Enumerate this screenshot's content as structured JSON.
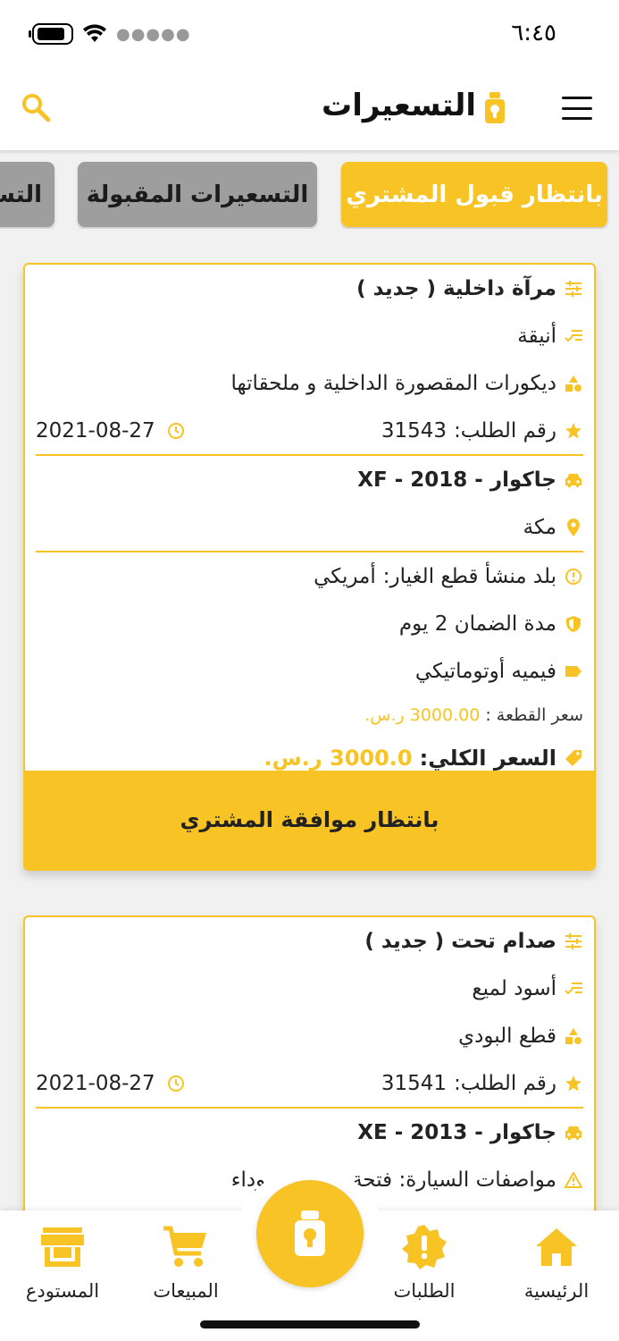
{
  "status_bar": {
    "time": "٦:٤٥"
  },
  "header": {
    "title": "التسعيرات"
  },
  "tabs": [
    {
      "label": "بانتظار قبول المشتري"
    },
    {
      "label": "التسعيرات المقبولة"
    },
    {
      "label": "التس"
    }
  ],
  "cards": [
    {
      "part": "مرآة داخلية ( جديد )",
      "quality": "أنيقة",
      "category": "ديكورات المقصورة الداخلية و ملحقاتها",
      "order_label": "رقم الطلب:",
      "order_number": "31543",
      "date": "2021-08-27",
      "car": "جاكوار - 2018 - XF",
      "city": "مكة",
      "origin_label": "بلد منشأ  قطع الغيار:",
      "origin": "أمريكي",
      "warranty": "مدة الضمان 2 يوم",
      "shipping": "فيميه أوتوماتيكي",
      "piece_price_label": "سعر القطعة :",
      "piece_price": "3000.00 ر.س.",
      "total_label": "السعر الكلي:",
      "total": "3000.0 ر.س.",
      "action": "بانتظار موافقة المشتري"
    },
    {
      "part": "صدام تحت ( جديد )",
      "quality": "أسود لميع",
      "category": "قطع البودي",
      "order_label": "رقم الطلب:",
      "order_number": "31541",
      "date": "2021-08-27",
      "car": "جاكوار - 2013 - XE",
      "specs": "مواصفات السيارة: فتحة سقف، سوداء"
    }
  ],
  "bottom_nav": {
    "home": "الرئيسية",
    "orders": "الطلبات",
    "sales": "المبيعات",
    "store": "المستودع"
  },
  "colors": {
    "accent": "#f7c325",
    "tab_inactive": "#9e9e9e"
  }
}
